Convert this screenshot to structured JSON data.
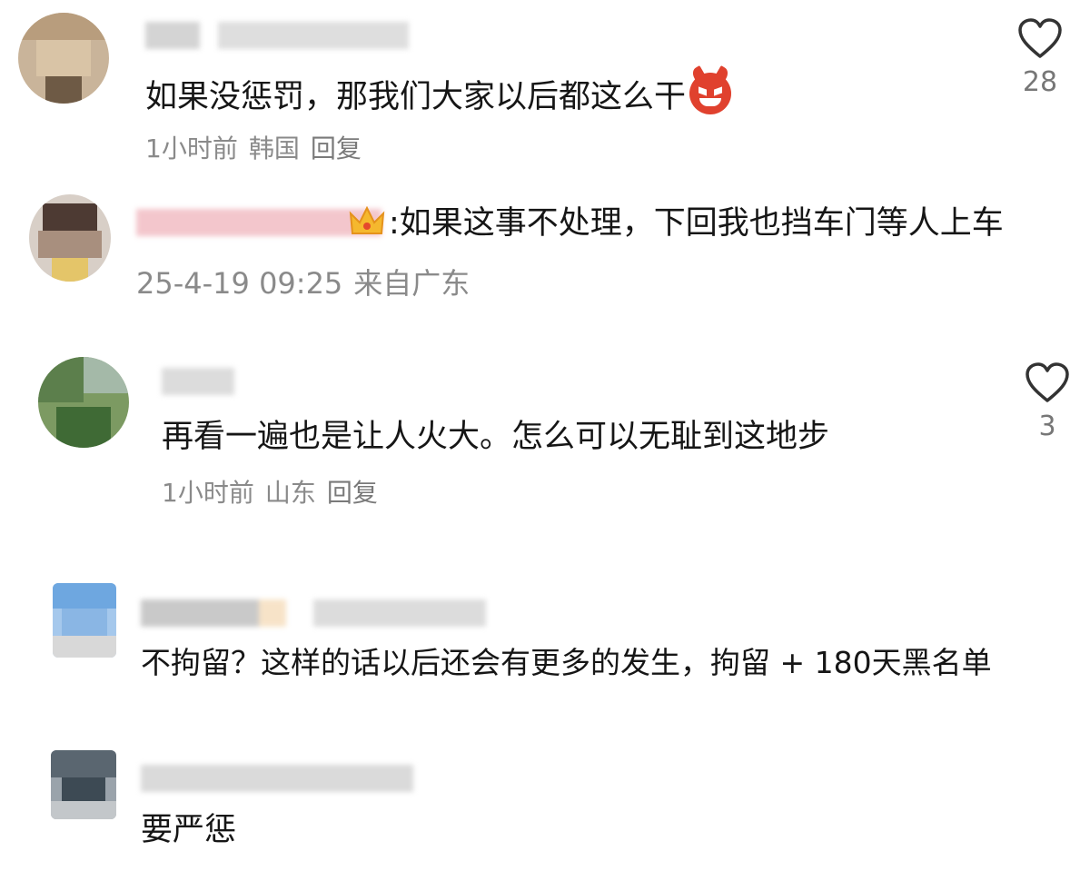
{
  "comments": [
    {
      "text": "如果没惩罚，那我们大家以后都这么干",
      "emoji": "angry-devil-emoji",
      "meta": {
        "time": "1小时前",
        "location": "韩国",
        "reply": "回复"
      },
      "likes": "28"
    },
    {
      "text": ":如果这事不处理，下回我也挡车门等人上车",
      "badge": "crown-icon",
      "meta": {
        "time": "25-4-19 09:25",
        "location": "来自广东"
      }
    },
    {
      "text": "再看一遍也是让人火大。怎么可以无耻到这地步",
      "meta": {
        "time": "1小时前",
        "location": "山东",
        "reply": "回复"
      },
      "likes": "3"
    },
    {
      "text": "不拘留？这样的话以后还会有更多的发生，拘留 + 180天黑名单"
    },
    {
      "text": "要严惩"
    }
  ],
  "colors": {
    "text": "#161616",
    "meta": "#8a8a8a",
    "devil": "#e0412e",
    "crown": "#f5b82e"
  }
}
